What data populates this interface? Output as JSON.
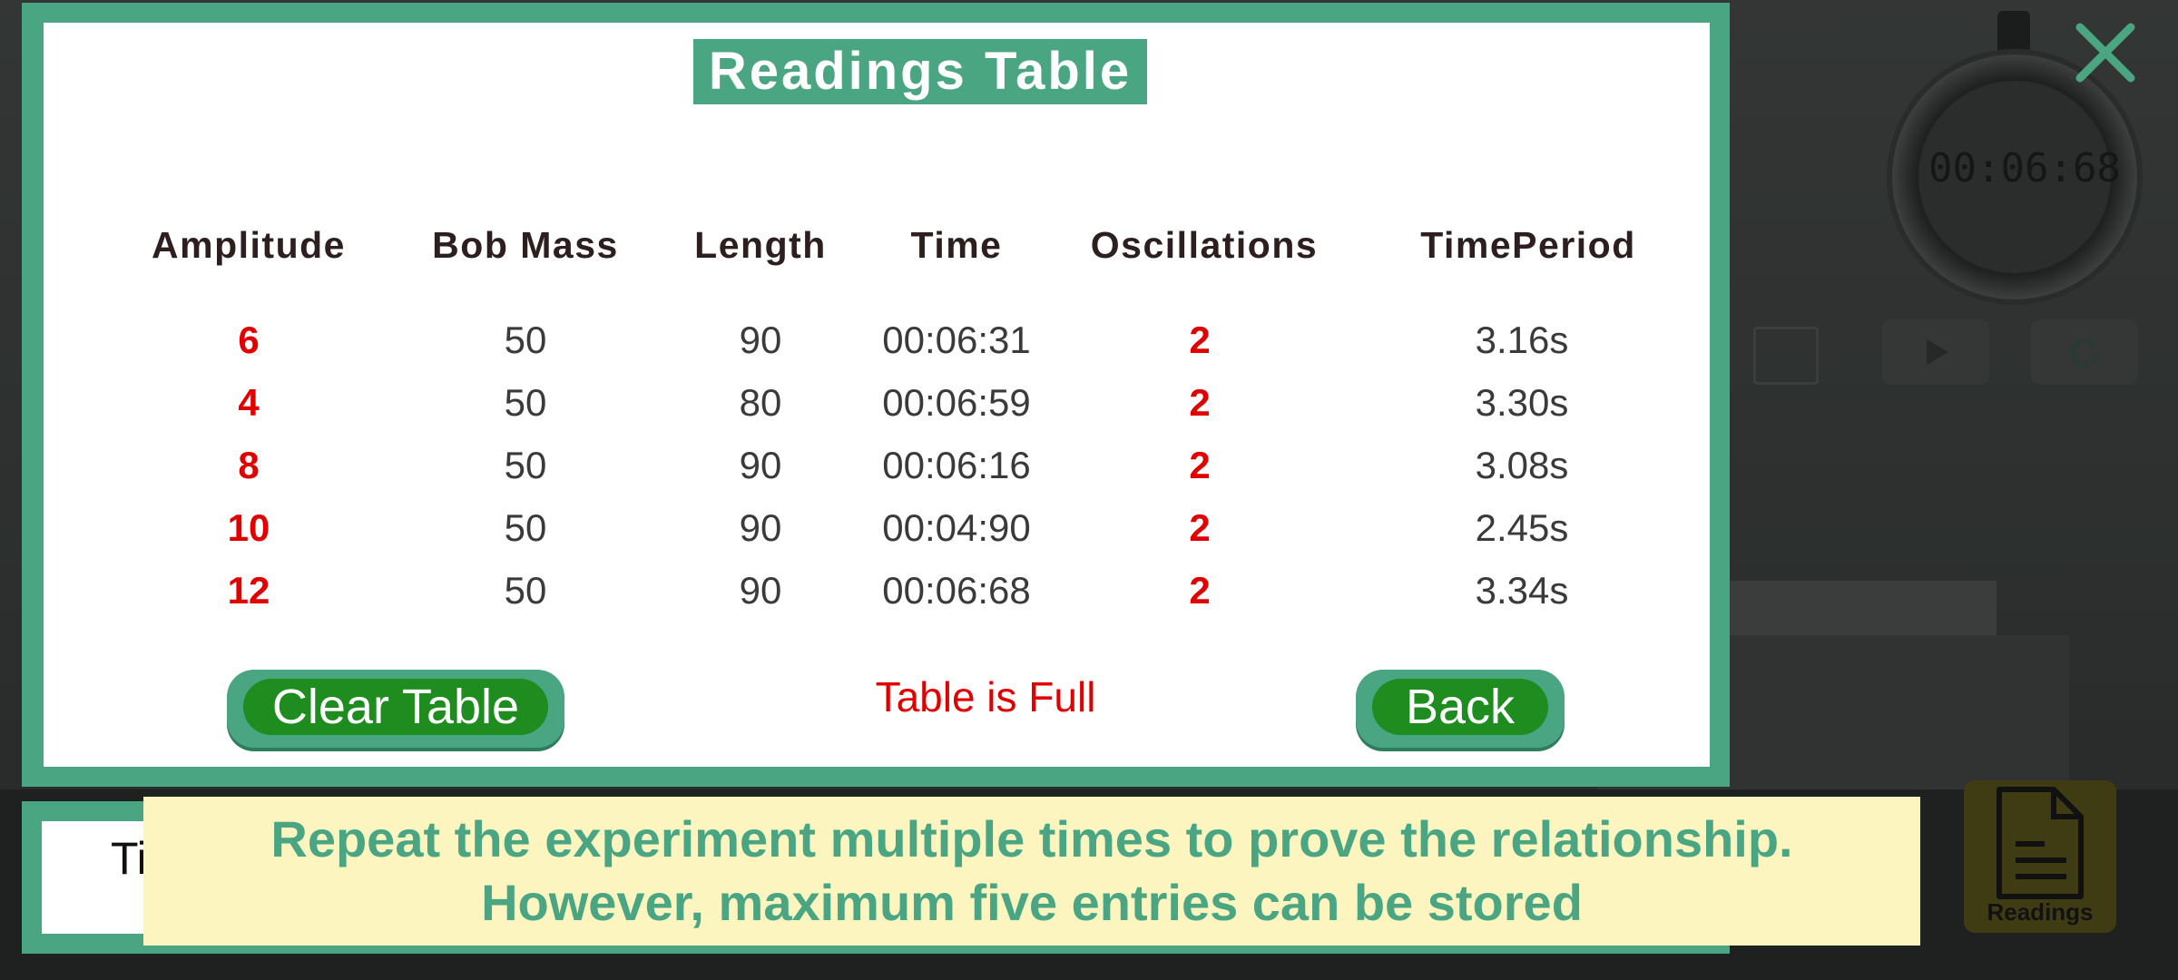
{
  "dialog": {
    "title": "Readings Table",
    "columns": [
      "Amplitude",
      "Bob Mass",
      "Length",
      "Time",
      "Oscillations",
      "TimePeriod"
    ],
    "rows": [
      {
        "amplitude": "6",
        "bob_mass": "50",
        "length": "90",
        "time": "00:06:31",
        "oscillations": "2",
        "time_period": "3.16s"
      },
      {
        "amplitude": "4",
        "bob_mass": "50",
        "length": "80",
        "time": "00:06:59",
        "oscillations": "2",
        "time_period": "3.30s"
      },
      {
        "amplitude": "8",
        "bob_mass": "50",
        "length": "90",
        "time": "00:06:16",
        "oscillations": "2",
        "time_period": "3.08s"
      },
      {
        "amplitude": "10",
        "bob_mass": "50",
        "length": "90",
        "time": "00:04:90",
        "oscillations": "2",
        "time_period": "2.45s"
      },
      {
        "amplitude": "12",
        "bob_mass": "50",
        "length": "90",
        "time": "00:06:68",
        "oscillations": "2",
        "time_period": "3.34s"
      }
    ],
    "status": "Table is Full",
    "clear_label": "Clear Table",
    "back_label": "Back"
  },
  "stopwatch": {
    "display": "00:06:68"
  },
  "readings_button": {
    "label": "Readings"
  },
  "bottom_bar": {
    "partial_label": "Ti"
  },
  "tip": {
    "line1": "Repeat the experiment multiple times to prove the relationship.",
    "line2": "However, maximum five entries can be stored"
  },
  "icons": {
    "close": "close-icon",
    "play": "play-icon",
    "reset": "reset-icon",
    "document": "document-icon"
  },
  "colors": {
    "frame": "#4aa582",
    "button": "#1e8c1e",
    "highlight": "#e10000",
    "tip_background": "#fcf5c0"
  }
}
